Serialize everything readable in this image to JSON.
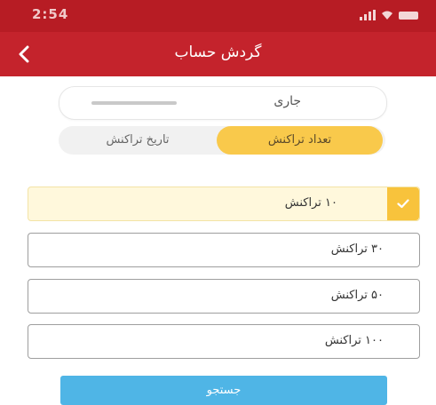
{
  "status_bar": {
    "time": "2:54"
  },
  "header": {
    "title": "گردش حساب",
    "back_icon": "chevron-left-icon"
  },
  "account": {
    "label": "جاری"
  },
  "filter_tabs": [
    {
      "label": "تعداد تراکنش",
      "active": true
    },
    {
      "label": "تاریخ تراکنش",
      "active": false
    }
  ],
  "options": [
    {
      "label": "۱۰ تراکنش",
      "selected": true
    },
    {
      "label": "۳۰ تراکنش",
      "selected": false
    },
    {
      "label": "۵۰ تراکنش",
      "selected": false
    },
    {
      "label": "۱۰۰ تراکنش",
      "selected": false
    }
  ],
  "search_button": {
    "label": "جستجو"
  },
  "colors": {
    "header": "#c4232c",
    "status_bar": "#b71c24",
    "accent": "#f9c94b",
    "selected_row": "#fff8dc",
    "button": "#4fb5e6"
  }
}
